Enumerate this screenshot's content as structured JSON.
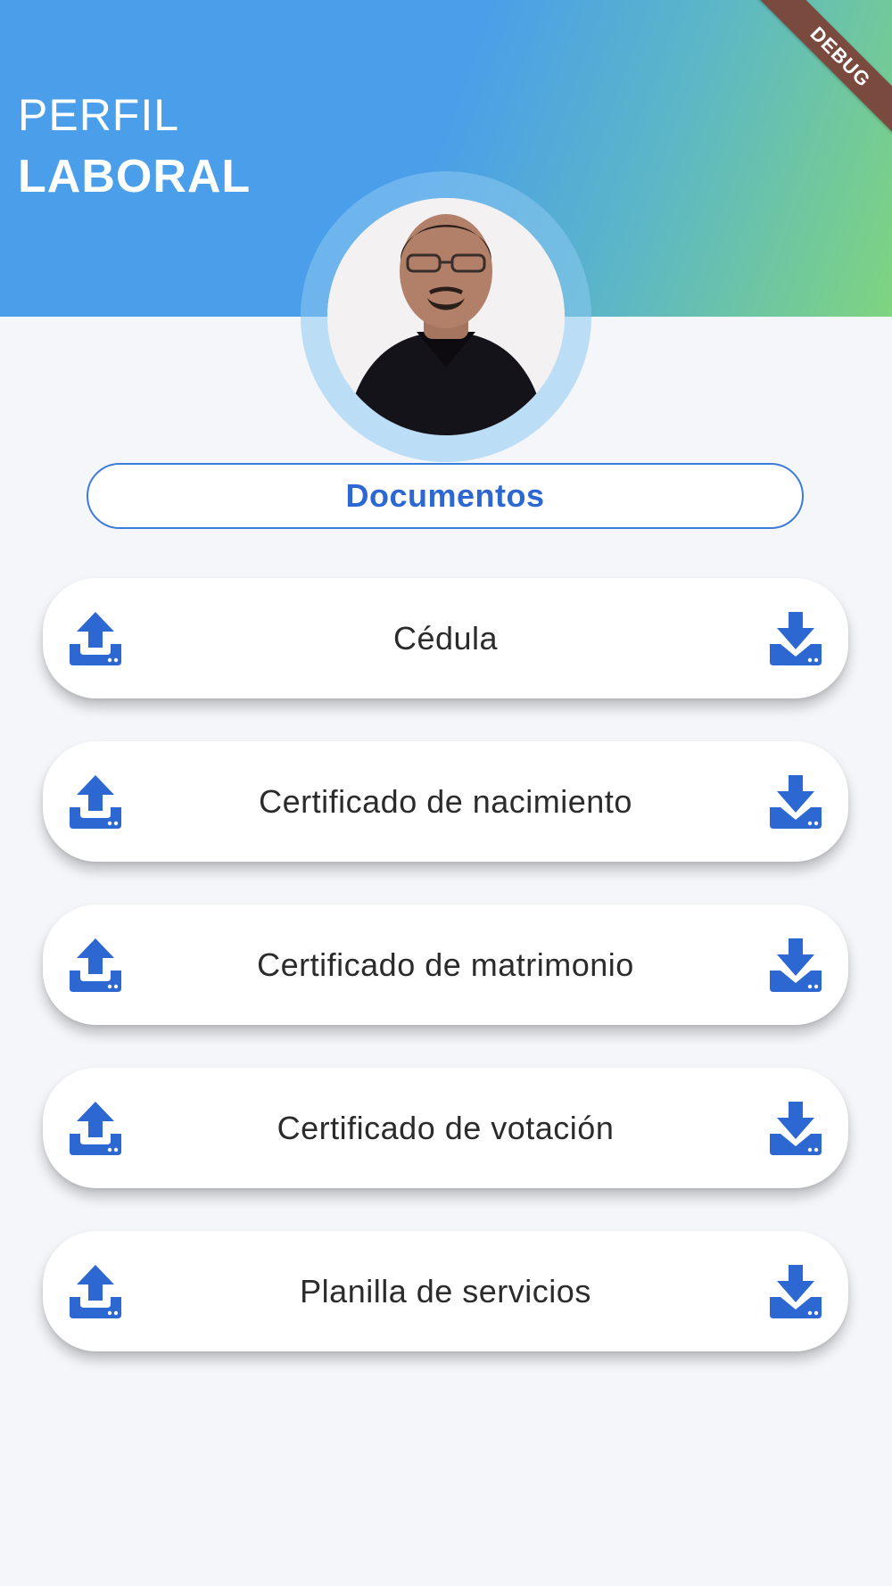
{
  "header": {
    "title_line1": "PERFIL",
    "title_line2": "LABORAL",
    "debug_banner": "DEBUG",
    "gradient_colors": [
      "#4a9eea",
      "#5cb7c6",
      "#7fd47f"
    ]
  },
  "section": {
    "title": "Documentos",
    "accent_color": "#2d68d2"
  },
  "documents": [
    {
      "label": "Cédula",
      "left_icon": "upload-icon",
      "right_icon": "download-icon"
    },
    {
      "label": "Certificado de nacimiento",
      "left_icon": "upload-icon",
      "right_icon": "download-icon"
    },
    {
      "label": "Certificado de matrimonio",
      "left_icon": "upload-icon",
      "right_icon": "download-icon"
    },
    {
      "label": "Certificado de votación",
      "left_icon": "upload-icon",
      "right_icon": "download-icon"
    },
    {
      "label": "Planilla de servicios",
      "left_icon": "upload-icon",
      "right_icon": "download-icon"
    }
  ],
  "colors": {
    "background": "#f4f6fa",
    "card": "#ffffff",
    "icon": "#2d68d2",
    "text": "#2b2b2b"
  }
}
